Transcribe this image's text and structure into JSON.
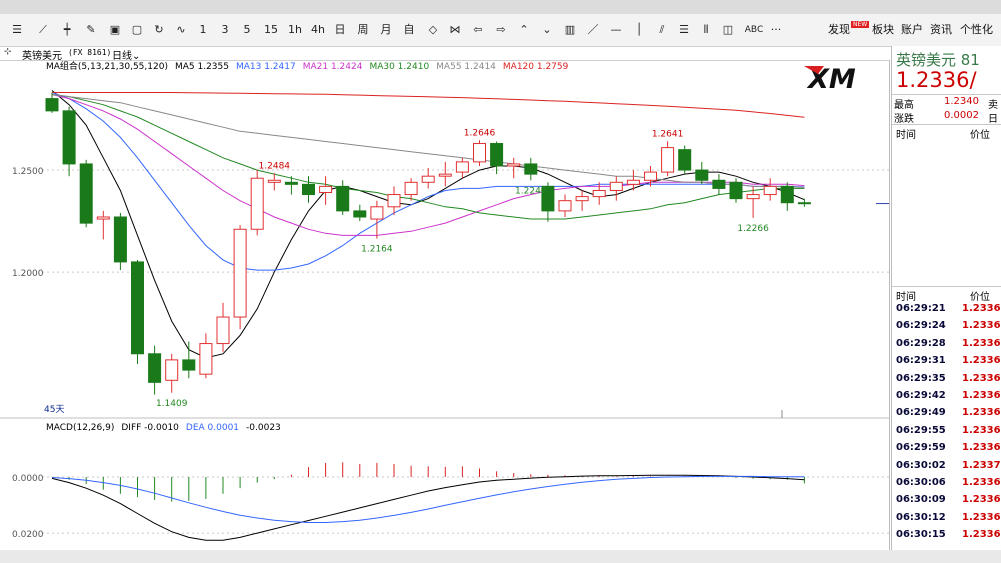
{
  "toolbar": {
    "icons": [
      "list-icon",
      "trend-icon",
      "candle-icon",
      "draw-icon",
      "save-icon",
      "window-icon",
      "refresh-icon",
      "chart-icon"
    ],
    "periods": [
      "1",
      "3",
      "5",
      "15",
      "1h",
      "4h",
      "日",
      "周",
      "月",
      "自"
    ],
    "right_items": {
      "discover": "发现",
      "discover_badge": "NEW",
      "sector": "板块",
      "account": "账户",
      "news": "资讯",
      "personalize": "个性化"
    },
    "abc_label": "ABC",
    "more_label": "···"
  },
  "title_bar": {
    "symbol": "英镑美元",
    "code": "(FX 8161)",
    "period": "日线"
  },
  "ma_legend": [
    {
      "text": "MA组合(5,13,21,30,55,120)",
      "color": "#000000"
    },
    {
      "text": "MA5 1.2355",
      "color": "#000000"
    },
    {
      "text": "MA13 1.2417",
      "color": "#3366ff"
    },
    {
      "text": "MA21 1.2424",
      "color": "#cc33cc"
    },
    {
      "text": "MA30 1.2410",
      "color": "#228822"
    },
    {
      "text": "MA55 1.2414",
      "color": "#888888"
    },
    {
      "text": "MA120 1.2759",
      "color": "#dd2222"
    }
  ],
  "logo": {
    "text": "XM"
  },
  "days_label": "45天",
  "price_axis_labels": {
    "a": "1.2500",
    "b": "1.2000"
  },
  "macd_axis_labels": {
    "a": "0.0000",
    "b": "0.0200"
  },
  "macd_legend": [
    {
      "text": "MACD(12,26,9)",
      "color": "#000000"
    },
    {
      "text": "DIFF -0.0010",
      "color": "#000000"
    },
    {
      "text": "DEA 0.0001",
      "color": "#3366ff"
    },
    {
      "text": "-0.0023",
      "color": "#000000"
    }
  ],
  "annotations": [
    {
      "text": "1.2484",
      "color": "#cc0000",
      "idx": 13
    },
    {
      "text": "1.2646",
      "color": "#cc0000",
      "idx": 25
    },
    {
      "text": "1.2641",
      "color": "#cc0000",
      "idx": 36
    },
    {
      "text": "1.2164",
      "color": "#228822",
      "idx": 19
    },
    {
      "text": "1.2247",
      "color": "#228822",
      "idx": 28
    },
    {
      "text": "1.2266",
      "color": "#228822",
      "idx": 41
    },
    {
      "text": "1.1409",
      "color": "#228822",
      "idx": 7
    }
  ],
  "colors": {
    "up": "#e03030",
    "down": "#1a7a1a"
  },
  "chart_data": {
    "type": "candlestick",
    "ylim": [
      1.13,
      1.3
    ],
    "candles": [
      [
        1.285,
        1.288,
        1.278,
        1.279
      ],
      [
        1.279,
        1.281,
        1.247,
        1.253
      ],
      [
        1.253,
        1.255,
        1.222,
        1.224
      ],
      [
        1.226,
        1.23,
        1.216,
        1.227
      ],
      [
        1.227,
        1.229,
        1.201,
        1.205
      ],
      [
        1.205,
        1.206,
        1.155,
        1.16
      ],
      [
        1.16,
        1.164,
        1.14,
        1.146
      ],
      [
        1.147,
        1.16,
        1.1409,
        1.157
      ],
      [
        1.157,
        1.166,
        1.148,
        1.152
      ],
      [
        1.15,
        1.17,
        1.148,
        1.165
      ],
      [
        1.165,
        1.185,
        1.161,
        1.178
      ],
      [
        1.178,
        1.223,
        1.172,
        1.221
      ],
      [
        1.221,
        1.25,
        1.218,
        1.246
      ],
      [
        1.244,
        1.2484,
        1.24,
        1.245
      ],
      [
        1.244,
        1.247,
        1.238,
        1.243
      ],
      [
        1.243,
        1.247,
        1.234,
        1.238
      ],
      [
        1.239,
        1.247,
        1.233,
        1.242
      ],
      [
        1.242,
        1.245,
        1.228,
        1.23
      ],
      [
        1.23,
        1.233,
        1.225,
        1.227
      ],
      [
        1.226,
        1.235,
        1.2164,
        1.232
      ],
      [
        1.232,
        1.242,
        1.228,
        1.238
      ],
      [
        1.238,
        1.246,
        1.235,
        1.244
      ],
      [
        1.244,
        1.251,
        1.241,
        1.247
      ],
      [
        1.247,
        1.254,
        1.242,
        1.248
      ],
      [
        1.249,
        1.256,
        1.246,
        1.254
      ],
      [
        1.254,
        1.2646,
        1.252,
        1.263
      ],
      [
        1.263,
        1.264,
        1.248,
        1.252
      ],
      [
        1.252,
        1.256,
        1.246,
        1.253
      ],
      [
        1.253,
        1.256,
        1.245,
        1.248
      ],
      [
        1.242,
        1.244,
        1.2247,
        1.23
      ],
      [
        1.23,
        1.238,
        1.227,
        1.235
      ],
      [
        1.235,
        1.24,
        1.23,
        1.237
      ],
      [
        1.237,
        1.244,
        1.233,
        1.24
      ],
      [
        1.24,
        1.247,
        1.235,
        1.244
      ],
      [
        1.243,
        1.25,
        1.24,
        1.245
      ],
      [
        1.245,
        1.252,
        1.242,
        1.249
      ],
      [
        1.249,
        1.2641,
        1.247,
        1.261
      ],
      [
        1.26,
        1.262,
        1.248,
        1.25
      ],
      [
        1.25,
        1.254,
        1.243,
        1.245
      ],
      [
        1.245,
        1.248,
        1.238,
        1.241
      ],
      [
        1.244,
        1.246,
        1.234,
        1.236
      ],
      [
        1.236,
        1.242,
        1.2266,
        1.238
      ],
      [
        1.238,
        1.246,
        1.235,
        1.242
      ],
      [
        1.242,
        1.244,
        1.23,
        1.234
      ],
      [
        1.234,
        1.236,
        1.232,
        1.2336
      ]
    ],
    "ma_lines": [
      {
        "name": "MA5",
        "color": "#000000",
        "values": [
          1.289,
          1.282,
          1.272,
          1.256,
          1.24,
          1.218,
          1.196,
          1.176,
          1.162,
          1.158,
          1.16,
          1.169,
          1.182,
          1.2,
          1.216,
          1.23,
          1.24,
          1.242,
          1.24,
          1.237,
          1.234,
          1.233,
          1.236,
          1.241,
          1.246,
          1.25,
          1.252,
          1.252,
          1.251,
          1.248,
          1.244,
          1.24,
          1.237,
          1.238,
          1.241,
          1.244,
          1.246,
          1.248,
          1.249,
          1.249,
          1.247,
          1.244,
          1.242,
          1.239,
          1.2355
        ]
      },
      {
        "name": "MA13",
        "color": "#3366ff",
        "values": [
          1.288,
          1.285,
          1.28,
          1.274,
          1.266,
          1.256,
          1.245,
          1.234,
          1.223,
          1.213,
          1.206,
          1.202,
          1.201,
          1.201,
          1.202,
          1.204,
          1.208,
          1.213,
          1.219,
          1.224,
          1.229,
          1.233,
          1.237,
          1.24,
          1.241,
          1.241,
          1.242,
          1.242,
          1.242,
          1.242,
          1.242,
          1.242,
          1.243,
          1.243,
          1.243,
          1.243,
          1.243,
          1.243,
          1.243,
          1.243,
          1.243,
          1.242,
          1.242,
          1.242,
          1.2417
        ]
      },
      {
        "name": "MA21",
        "color": "#cc33cc",
        "values": [
          1.287,
          1.285,
          1.282,
          1.279,
          1.275,
          1.27,
          1.264,
          1.258,
          1.252,
          1.246,
          1.24,
          1.235,
          1.231,
          1.227,
          1.224,
          1.221,
          1.219,
          1.218,
          1.218,
          1.218,
          1.219,
          1.22,
          1.222,
          1.224,
          1.227,
          1.23,
          1.233,
          1.236,
          1.238,
          1.24,
          1.241,
          1.242,
          1.242,
          1.242,
          1.243,
          1.244,
          1.244,
          1.244,
          1.244,
          1.244,
          1.244,
          1.243,
          1.243,
          1.243,
          1.2424
        ]
      },
      {
        "name": "MA30",
        "color": "#228822",
        "values": [
          1.287,
          1.286,
          1.284,
          1.282,
          1.279,
          1.276,
          1.272,
          1.268,
          1.264,
          1.26,
          1.256,
          1.253,
          1.25,
          1.248,
          1.246,
          1.244,
          1.243,
          1.241,
          1.24,
          1.239,
          1.237,
          1.236,
          1.234,
          1.232,
          1.231,
          1.229,
          1.228,
          1.227,
          1.226,
          1.226,
          1.226,
          1.227,
          1.228,
          1.229,
          1.23,
          1.231,
          1.233,
          1.234,
          1.236,
          1.238,
          1.239,
          1.24,
          1.241,
          1.241,
          1.241
        ]
      },
      {
        "name": "MA55",
        "color": "#888888",
        "values": [
          1.287,
          1.286,
          1.285,
          1.284,
          1.283,
          1.281,
          1.279,
          1.277,
          1.275,
          1.273,
          1.271,
          1.269,
          1.268,
          1.267,
          1.266,
          1.265,
          1.264,
          1.263,
          1.262,
          1.261,
          1.26,
          1.259,
          1.258,
          1.257,
          1.256,
          1.255,
          1.254,
          1.253,
          1.252,
          1.251,
          1.25,
          1.249,
          1.248,
          1.247,
          1.247,
          1.246,
          1.245,
          1.244,
          1.244,
          1.243,
          1.243,
          1.242,
          1.242,
          1.242,
          1.2414
        ]
      },
      {
        "name": "MA120",
        "color": "#dd2222",
        "values": [
          1.288,
          1.288,
          1.288,
          1.288,
          1.288,
          1.288,
          1.288,
          1.288,
          1.2879,
          1.2878,
          1.2877,
          1.2876,
          1.2875,
          1.2874,
          1.2873,
          1.2872,
          1.2871,
          1.2869,
          1.2867,
          1.2865,
          1.2863,
          1.2861,
          1.2859,
          1.2857,
          1.2855,
          1.2852,
          1.2849,
          1.2846,
          1.2843,
          1.284,
          1.2837,
          1.2833,
          1.2829,
          1.2825,
          1.2821,
          1.2817,
          1.2813,
          1.2808,
          1.2803,
          1.2798,
          1.2793,
          1.2785,
          1.2777,
          1.2768,
          1.2759
        ]
      }
    ],
    "macd": {
      "ylim": [
        -0.026,
        0.016
      ],
      "bars": [
        0.0,
        -0.001,
        -0.0025,
        -0.0045,
        -0.006,
        -0.0072,
        -0.0082,
        -0.0088,
        -0.0085,
        -0.0078,
        -0.006,
        -0.004,
        -0.002,
        -0.0008,
        0.0008,
        0.0035,
        0.005,
        0.0052,
        0.0046,
        0.005,
        0.0046,
        0.004,
        0.0038,
        0.0036,
        0.0038,
        0.003,
        0.002,
        0.0014,
        0.001,
        0.0008,
        0.0006,
        0.0004,
        0.0004,
        0.0002,
        0.0003,
        0.0002,
        0.0002,
        0.0003,
        0.0001,
        0.0,
        -0.0004,
        -0.0006,
        -0.0008,
        -0.001,
        -0.0023
      ],
      "diff": [
        -0.0005,
        -0.002,
        -0.004,
        -0.0065,
        -0.0095,
        -0.013,
        -0.0165,
        -0.0195,
        -0.0215,
        -0.0225,
        -0.0225,
        -0.0215,
        -0.02,
        -0.0185,
        -0.017,
        -0.0155,
        -0.014,
        -0.0125,
        -0.011,
        -0.0095,
        -0.008,
        -0.0065,
        -0.005,
        -0.0038,
        -0.0028,
        -0.0018,
        -0.0012,
        -0.0008,
        -0.0004,
        -0.0001,
        0.0001,
        0.0003,
        0.0004,
        0.0004,
        0.0005,
        0.0006,
        0.0006,
        0.0006,
        0.0005,
        0.0004,
        0.0002,
        0.0,
        -0.0003,
        -0.0006,
        -0.001
      ],
      "dea": [
        -0.0002,
        -0.0006,
        -0.0012,
        -0.002,
        -0.003,
        -0.0043,
        -0.0058,
        -0.0075,
        -0.0092,
        -0.0108,
        -0.0123,
        -0.0136,
        -0.0146,
        -0.0154,
        -0.0159,
        -0.0162,
        -0.0162,
        -0.0159,
        -0.0154,
        -0.0146,
        -0.0137,
        -0.0126,
        -0.0114,
        -0.0101,
        -0.0088,
        -0.0076,
        -0.0064,
        -0.0053,
        -0.0043,
        -0.0034,
        -0.0026,
        -0.0019,
        -0.0013,
        -0.0008,
        -0.0005,
        -0.0002,
        0.0,
        0.0001,
        0.0002,
        0.0002,
        0.0002,
        0.0002,
        0.0001,
        0.0001,
        0.0001
      ]
    }
  },
  "right_panel": {
    "name": "英镑美元 81",
    "price": "1.2336/",
    "high_label": "最高",
    "high_value": "1.2340",
    "high_extra": "卖",
    "change_label": "涨跌",
    "change_value": "0.0002",
    "change_extra": "日",
    "time_label": "时间",
    "price_label": "价位",
    "ticks": [
      {
        "time": "06:29:21",
        "price": "1.2336"
      },
      {
        "time": "06:29:24",
        "price": "1.2336"
      },
      {
        "time": "06:29:28",
        "price": "1.2336"
      },
      {
        "time": "06:29:31",
        "price": "1.2336"
      },
      {
        "time": "06:29:35",
        "price": "1.2336"
      },
      {
        "time": "06:29:42",
        "price": "1.2336"
      },
      {
        "time": "06:29:49",
        "price": "1.2336"
      },
      {
        "time": "06:29:55",
        "price": "1.2336"
      },
      {
        "time": "06:29:59",
        "price": "1.2336"
      },
      {
        "time": "06:30:02",
        "price": "1.2337"
      },
      {
        "time": "06:30:06",
        "price": "1.2336"
      },
      {
        "time": "06:30:09",
        "price": "1.2336"
      },
      {
        "time": "06:30:12",
        "price": "1.2336"
      },
      {
        "time": "06:30:15",
        "price": "1.2336"
      }
    ]
  }
}
